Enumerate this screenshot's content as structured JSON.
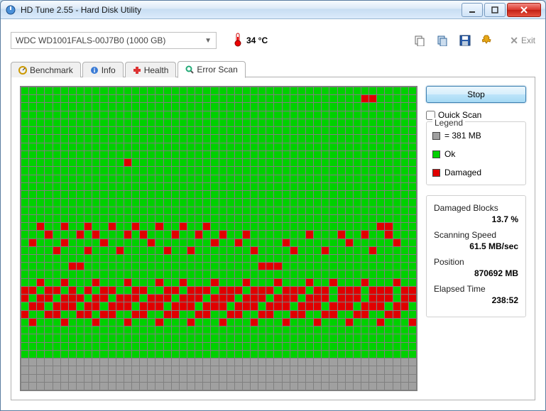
{
  "window": {
    "title": "HD Tune 2.55 - Hard Disk Utility"
  },
  "toolbar": {
    "drive": "WDC WD1001FALS-00J7B0 (1000 GB)",
    "temp": "34 °C",
    "exit_label": "Exit"
  },
  "tabs": {
    "benchmark": "Benchmark",
    "info": "Info",
    "health": "Health",
    "errorscan": "Error Scan"
  },
  "scan": {
    "stop_label": "Stop",
    "quickscan_label": "Quick Scan",
    "legend_title": "Legend",
    "block_size": "= 381 MB",
    "ok_label": "Ok",
    "damaged_label": "Damaged"
  },
  "stats": {
    "damaged_label": "Damaged Blocks",
    "damaged_value": "13.7 %",
    "speed_label": "Scanning Speed",
    "speed_value": "61.5 MB/sec",
    "position_label": "Position",
    "position_value": "870692 MB",
    "elapsed_label": "Elapsed Time",
    "elapsed_value": "238:52"
  },
  "chart_data": {
    "type": "heatmap",
    "title": "Error Scan block map",
    "cols": 50,
    "rows": 38,
    "legend": {
      "ok": "green",
      "damaged": "red",
      "unscanned": "gray"
    },
    "damaged_cells": [
      [
        1,
        43
      ],
      [
        1,
        44
      ],
      [
        9,
        13
      ],
      [
        17,
        2
      ],
      [
        17,
        5
      ],
      [
        17,
        8
      ],
      [
        17,
        11
      ],
      [
        17,
        14
      ],
      [
        17,
        17
      ],
      [
        17,
        20
      ],
      [
        17,
        23
      ],
      [
        17,
        45
      ],
      [
        17,
        46
      ],
      [
        18,
        3
      ],
      [
        18,
        7
      ],
      [
        18,
        9
      ],
      [
        18,
        13
      ],
      [
        18,
        15
      ],
      [
        18,
        19
      ],
      [
        18,
        22
      ],
      [
        18,
        25
      ],
      [
        18,
        28
      ],
      [
        18,
        36
      ],
      [
        18,
        40
      ],
      [
        18,
        43
      ],
      [
        18,
        46
      ],
      [
        19,
        1
      ],
      [
        19,
        5
      ],
      [
        19,
        10
      ],
      [
        19,
        16
      ],
      [
        19,
        24
      ],
      [
        19,
        27
      ],
      [
        19,
        33
      ],
      [
        19,
        41
      ],
      [
        19,
        47
      ],
      [
        20,
        4
      ],
      [
        20,
        8
      ],
      [
        20,
        12
      ],
      [
        20,
        18
      ],
      [
        20,
        21
      ],
      [
        20,
        29
      ],
      [
        20,
        34
      ],
      [
        20,
        38
      ],
      [
        20,
        44
      ],
      [
        22,
        6
      ],
      [
        22,
        7
      ],
      [
        22,
        30
      ],
      [
        22,
        31
      ],
      [
        22,
        32
      ],
      [
        24,
        2
      ],
      [
        24,
        5
      ],
      [
        24,
        9
      ],
      [
        24,
        13
      ],
      [
        24,
        17
      ],
      [
        24,
        20
      ],
      [
        24,
        24
      ],
      [
        24,
        28
      ],
      [
        24,
        32
      ],
      [
        24,
        36
      ],
      [
        24,
        39
      ],
      [
        24,
        43
      ],
      [
        24,
        47
      ],
      [
        25,
        0
      ],
      [
        25,
        1
      ],
      [
        25,
        3
      ],
      [
        25,
        4
      ],
      [
        25,
        6
      ],
      [
        25,
        8
      ],
      [
        25,
        10
      ],
      [
        25,
        11
      ],
      [
        25,
        14
      ],
      [
        25,
        15
      ],
      [
        25,
        18
      ],
      [
        25,
        19
      ],
      [
        25,
        21
      ],
      [
        25,
        22
      ],
      [
        25,
        23
      ],
      [
        25,
        25
      ],
      [
        25,
        26
      ],
      [
        25,
        27
      ],
      [
        25,
        29
      ],
      [
        25,
        30
      ],
      [
        25,
        31
      ],
      [
        25,
        33
      ],
      [
        25,
        34
      ],
      [
        25,
        35
      ],
      [
        25,
        37
      ],
      [
        25,
        38
      ],
      [
        25,
        40
      ],
      [
        25,
        41
      ],
      [
        25,
        42
      ],
      [
        25,
        44
      ],
      [
        25,
        45
      ],
      [
        25,
        46
      ],
      [
        25,
        48
      ],
      [
        25,
        49
      ],
      [
        26,
        0
      ],
      [
        26,
        2
      ],
      [
        26,
        3
      ],
      [
        26,
        5
      ],
      [
        26,
        6
      ],
      [
        26,
        7
      ],
      [
        26,
        9
      ],
      [
        26,
        10
      ],
      [
        26,
        12
      ],
      [
        26,
        13
      ],
      [
        26,
        14
      ],
      [
        26,
        16
      ],
      [
        26,
        17
      ],
      [
        26,
        18
      ],
      [
        26,
        20
      ],
      [
        26,
        21
      ],
      [
        26,
        22
      ],
      [
        26,
        24
      ],
      [
        26,
        25
      ],
      [
        26,
        26
      ],
      [
        26,
        28
      ],
      [
        26,
        29
      ],
      [
        26,
        30
      ],
      [
        26,
        32
      ],
      [
        26,
        33
      ],
      [
        26,
        34
      ],
      [
        26,
        36
      ],
      [
        26,
        37
      ],
      [
        26,
        38
      ],
      [
        26,
        40
      ],
      [
        26,
        41
      ],
      [
        26,
        42
      ],
      [
        26,
        44
      ],
      [
        26,
        45
      ],
      [
        26,
        46
      ],
      [
        26,
        48
      ],
      [
        26,
        49
      ],
      [
        27,
        1
      ],
      [
        27,
        2
      ],
      [
        27,
        4
      ],
      [
        27,
        5
      ],
      [
        27,
        6
      ],
      [
        27,
        8
      ],
      [
        27,
        9
      ],
      [
        27,
        11
      ],
      [
        27,
        12
      ],
      [
        27,
        13
      ],
      [
        27,
        15
      ],
      [
        27,
        16
      ],
      [
        27,
        17
      ],
      [
        27,
        19
      ],
      [
        27,
        20
      ],
      [
        27,
        21
      ],
      [
        27,
        23
      ],
      [
        27,
        24
      ],
      [
        27,
        25
      ],
      [
        27,
        27
      ],
      [
        27,
        28
      ],
      [
        27,
        29
      ],
      [
        27,
        31
      ],
      [
        27,
        32
      ],
      [
        27,
        33
      ],
      [
        27,
        35
      ],
      [
        27,
        36
      ],
      [
        27,
        37
      ],
      [
        27,
        39
      ],
      [
        27,
        40
      ],
      [
        27,
        41
      ],
      [
        27,
        43
      ],
      [
        27,
        44
      ],
      [
        27,
        45
      ],
      [
        27,
        47
      ],
      [
        27,
        48
      ],
      [
        28,
        0
      ],
      [
        28,
        3
      ],
      [
        28,
        4
      ],
      [
        28,
        7
      ],
      [
        28,
        8
      ],
      [
        28,
        10
      ],
      [
        28,
        11
      ],
      [
        28,
        14
      ],
      [
        28,
        15
      ],
      [
        28,
        18
      ],
      [
        28,
        19
      ],
      [
        28,
        22
      ],
      [
        28,
        23
      ],
      [
        28,
        26
      ],
      [
        28,
        27
      ],
      [
        28,
        30
      ],
      [
        28,
        31
      ],
      [
        28,
        34
      ],
      [
        28,
        35
      ],
      [
        28,
        38
      ],
      [
        28,
        39
      ],
      [
        28,
        42
      ],
      [
        28,
        43
      ],
      [
        28,
        46
      ],
      [
        28,
        47
      ],
      [
        29,
        1
      ],
      [
        29,
        5
      ],
      [
        29,
        9
      ],
      [
        29,
        13
      ],
      [
        29,
        17
      ],
      [
        29,
        21
      ],
      [
        29,
        25
      ],
      [
        29,
        29
      ],
      [
        29,
        33
      ],
      [
        29,
        37
      ],
      [
        29,
        41
      ],
      [
        29,
        45
      ],
      [
        29,
        49
      ]
    ],
    "unscanned_rows_from": 34
  }
}
